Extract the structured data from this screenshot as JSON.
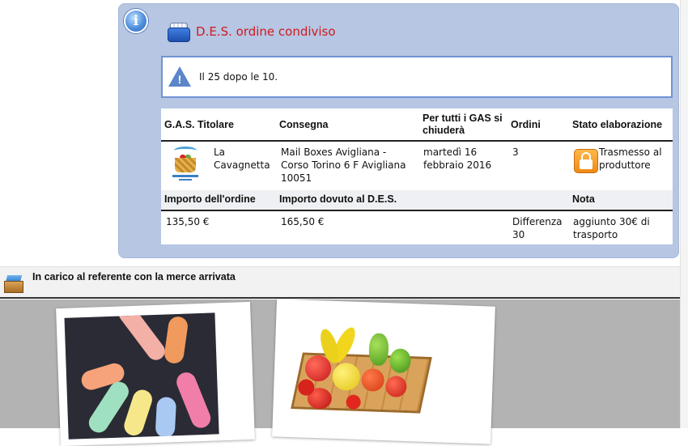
{
  "order": {
    "title": "D.E.S. ordine condiviso",
    "alert": "Il 25 dopo le 10.",
    "headers": {
      "gas": "G.A.S. Titolare",
      "consegna": "Consegna",
      "chiusura": "Per tutti i GAS si chiuderà",
      "ordini": "Ordini",
      "stato": "Stato elaborazione"
    },
    "row": {
      "gas_name": "La Cavagnetta",
      "consegna": "Mail Boxes Avigliana - Corso Torino 6 F Avigliana 10051",
      "chiusura": "martedì 16 febbraio 2016",
      "ordini": "3",
      "stato": "Trasmesso al produttore"
    },
    "headers2": {
      "importo": "Importo dell'ordine",
      "dovuto": "Importo dovuto al D.E.S.",
      "nota": "Nota"
    },
    "row2": {
      "importo": "135,50 €",
      "dovuto": "165,50 €",
      "differenza": "Differenza 30",
      "nota": "aggiunto 30€ di trasporto"
    }
  },
  "section": {
    "title": "In carico al referente con la merce arrivata"
  },
  "icons": {
    "info": "info-icon",
    "title": "shopping-basket-icon",
    "alert": "warning-icon",
    "stato": "lock-icon",
    "section": "box-icon"
  },
  "colors": {
    "panel": "#b6c6e3",
    "title": "#d2191e",
    "alert_border": "#6f93d5",
    "gallery": "#b3b3b3"
  }
}
